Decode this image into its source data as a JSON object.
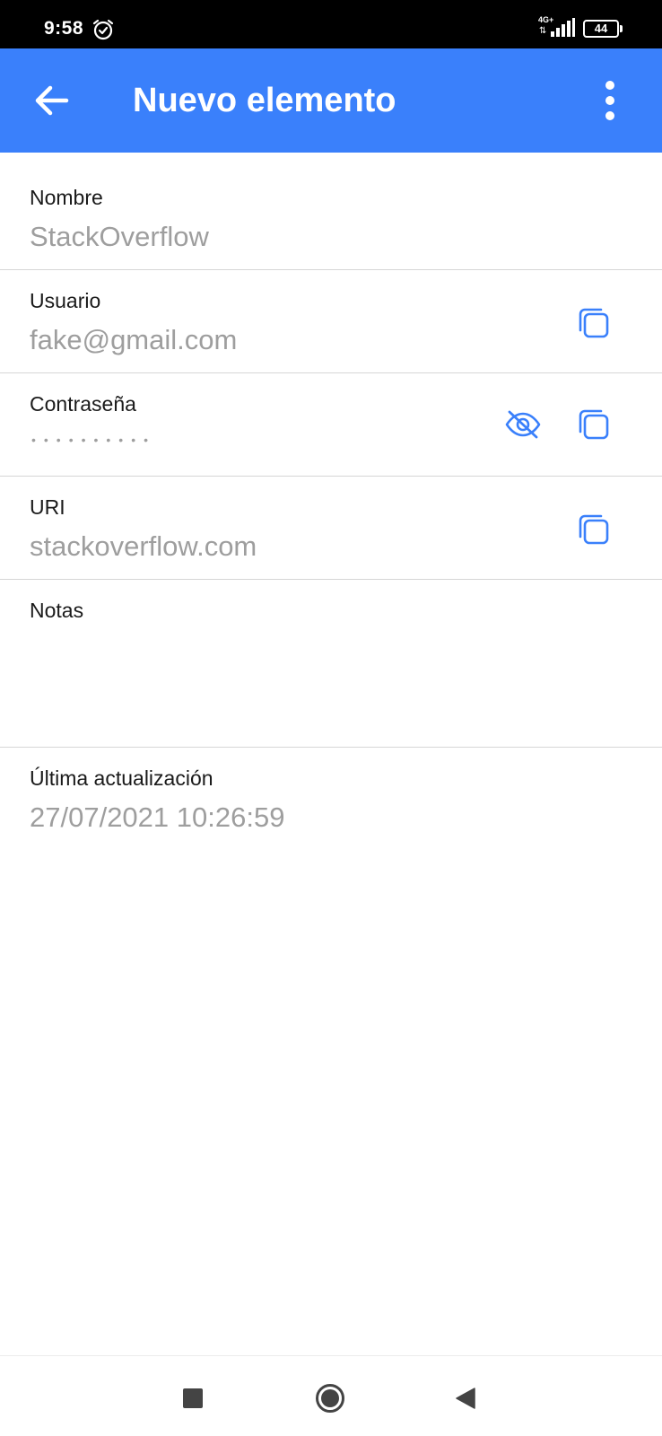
{
  "status_bar": {
    "time": "9:58",
    "network": "4G+",
    "network_arrows": "⇅",
    "battery": "44",
    "icons": [
      "alarm-icon",
      "signal-icon",
      "battery-icon"
    ]
  },
  "app_bar": {
    "title": "Nuevo elemento",
    "back_icon": "arrow-back-icon",
    "menu_icon": "more-vert-icon",
    "background_color": "#3a80fb"
  },
  "fields": {
    "nombre": {
      "label": "Nombre",
      "value": "StackOverflow"
    },
    "usuario": {
      "label": "Usuario",
      "value": "fake@gmail.com",
      "action_icon": "copy-icon"
    },
    "contrasena": {
      "label": "Contraseña",
      "value": "••••••••••",
      "action_icons": [
        "visibility-off-icon",
        "copy-icon"
      ]
    },
    "uri": {
      "label": "URI",
      "value": "stackoverflow.com",
      "action_icon": "copy-icon"
    },
    "notas": {
      "label": "Notas",
      "value": ""
    },
    "ultima_actualizacion": {
      "label": "Última actualización",
      "value": "27/07/2021 10:26:59"
    }
  },
  "colors": {
    "accent": "#3a80fb",
    "icon_blue": "#3a80fb",
    "label_text": "#1a1a1a",
    "value_text": "#9e9e9e",
    "divider": "#d6d6d6"
  },
  "nav_bar": {
    "icons": [
      "recents-square-icon",
      "home-circle-icon",
      "back-triangle-icon"
    ]
  }
}
